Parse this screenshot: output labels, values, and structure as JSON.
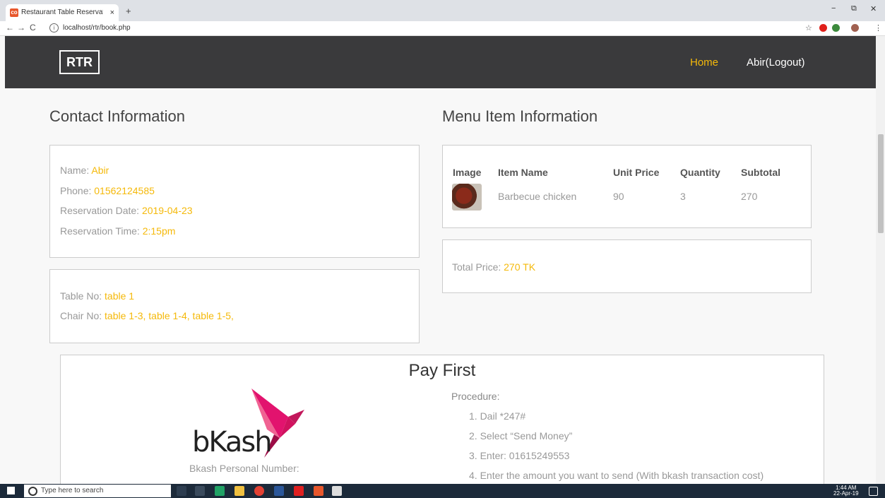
{
  "browser": {
    "tab_title": "Restaurant Table Reservation Sys",
    "tab_close": "×",
    "new_tab": "+",
    "url": "localhost/rtr/book.php",
    "back": "←",
    "forward": "→",
    "reload": "C",
    "win_min": "−",
    "win_max": "⧉",
    "win_close": "✕",
    "star": "☆"
  },
  "nav": {
    "logo": "RTR",
    "home": "Home",
    "user": "Abir(Logout)"
  },
  "contact": {
    "heading": "Contact Information",
    "name_label": "Name: ",
    "name": "Abir",
    "phone_label": "Phone: ",
    "phone": "01562124585",
    "date_label": "Reservation Date: ",
    "date": "2019-04-23",
    "time_label": "Reservation Time: ",
    "time": "2:15pm",
    "table_label": "Table No: ",
    "table": "table 1",
    "chair_label": "Chair No: ",
    "chairs": "table 1-3, table 1-4, table 1-5,"
  },
  "menu": {
    "heading": "Menu Item Information",
    "columns": [
      "Image",
      "Item Name",
      "Unit Price",
      "Quantity",
      "Subtotal"
    ],
    "rows": [
      {
        "item": "Barbecue chicken",
        "unit_price": "90",
        "quantity": "3",
        "subtotal": "270"
      }
    ],
    "total_label": "Total Price: ",
    "total": "270 TK"
  },
  "pay": {
    "title": "Pay First",
    "brand": "bKash",
    "number_label": "Bkash Personal Number:",
    "procedure_label": "Procedure:",
    "steps": [
      "1. Dail *247#",
      "2. Select “Send Money”",
      "3. Enter: 01615249553",
      "4. Enter the amount you want to send (With bkash transaction cost)"
    ]
  },
  "taskbar": {
    "search_placeholder": "Type here to search",
    "time": "1:44 AM",
    "date": "22-Apr-19"
  }
}
